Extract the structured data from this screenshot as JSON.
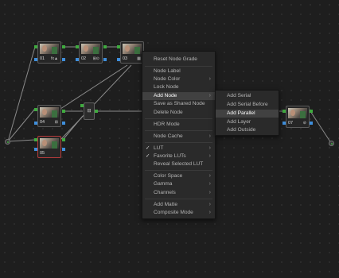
{
  "nodes": [
    {
      "label": "01",
      "icons": "fx▲"
    },
    {
      "label": "02",
      "icons": "⊞⊙"
    },
    {
      "label": "03",
      "icons": "▦"
    },
    {
      "label": "04",
      "icons": "⊞"
    },
    {
      "label": "05",
      "icons": ""
    },
    {
      "label": "07",
      "icons": "⊘"
    }
  ],
  "context_menu": {
    "items": [
      {
        "label": "Reset Node Grade"
      },
      {
        "label": "Node Label"
      },
      {
        "label": "Node Color",
        "submenu": true
      },
      {
        "label": "Lock Node"
      },
      {
        "label": "Add Node",
        "submenu": true,
        "highlighted": true
      },
      {
        "label": "Save as Shared Node"
      },
      {
        "label": "Delete Node"
      },
      {
        "label": "HDR Mode"
      },
      {
        "label": "Node Cache",
        "submenu": true
      },
      {
        "label": "LUT",
        "submenu": true,
        "checked": true
      },
      {
        "label": "Favorite LUTs",
        "submenu": true,
        "checked": true
      },
      {
        "label": "Reveal Selected LUT"
      },
      {
        "label": "Color Space",
        "submenu": true
      },
      {
        "label": "Gamma",
        "submenu": true
      },
      {
        "label": "Channels",
        "submenu": true
      },
      {
        "label": "Add Matte",
        "submenu": true
      },
      {
        "label": "Composite Mode",
        "submenu": true
      }
    ],
    "check_glyph": "✓",
    "arrow_glyph": "›"
  },
  "add_node_submenu": {
    "items": [
      {
        "label": "Add Serial"
      },
      {
        "label": "Add Serial Before"
      },
      {
        "label": "Add Parallel",
        "highlighted": true
      },
      {
        "label": "Add Layer"
      },
      {
        "label": "Add Outside"
      }
    ]
  },
  "colors": {
    "background": "#1e1e1e",
    "wire": "#8a8a8a",
    "port_rgb": "#3faa3f",
    "port_alpha": "#3f8fdc",
    "selected_border": "#b53b3b",
    "menu_bg": "#2a2a2a",
    "menu_highlight": "#414141"
  }
}
